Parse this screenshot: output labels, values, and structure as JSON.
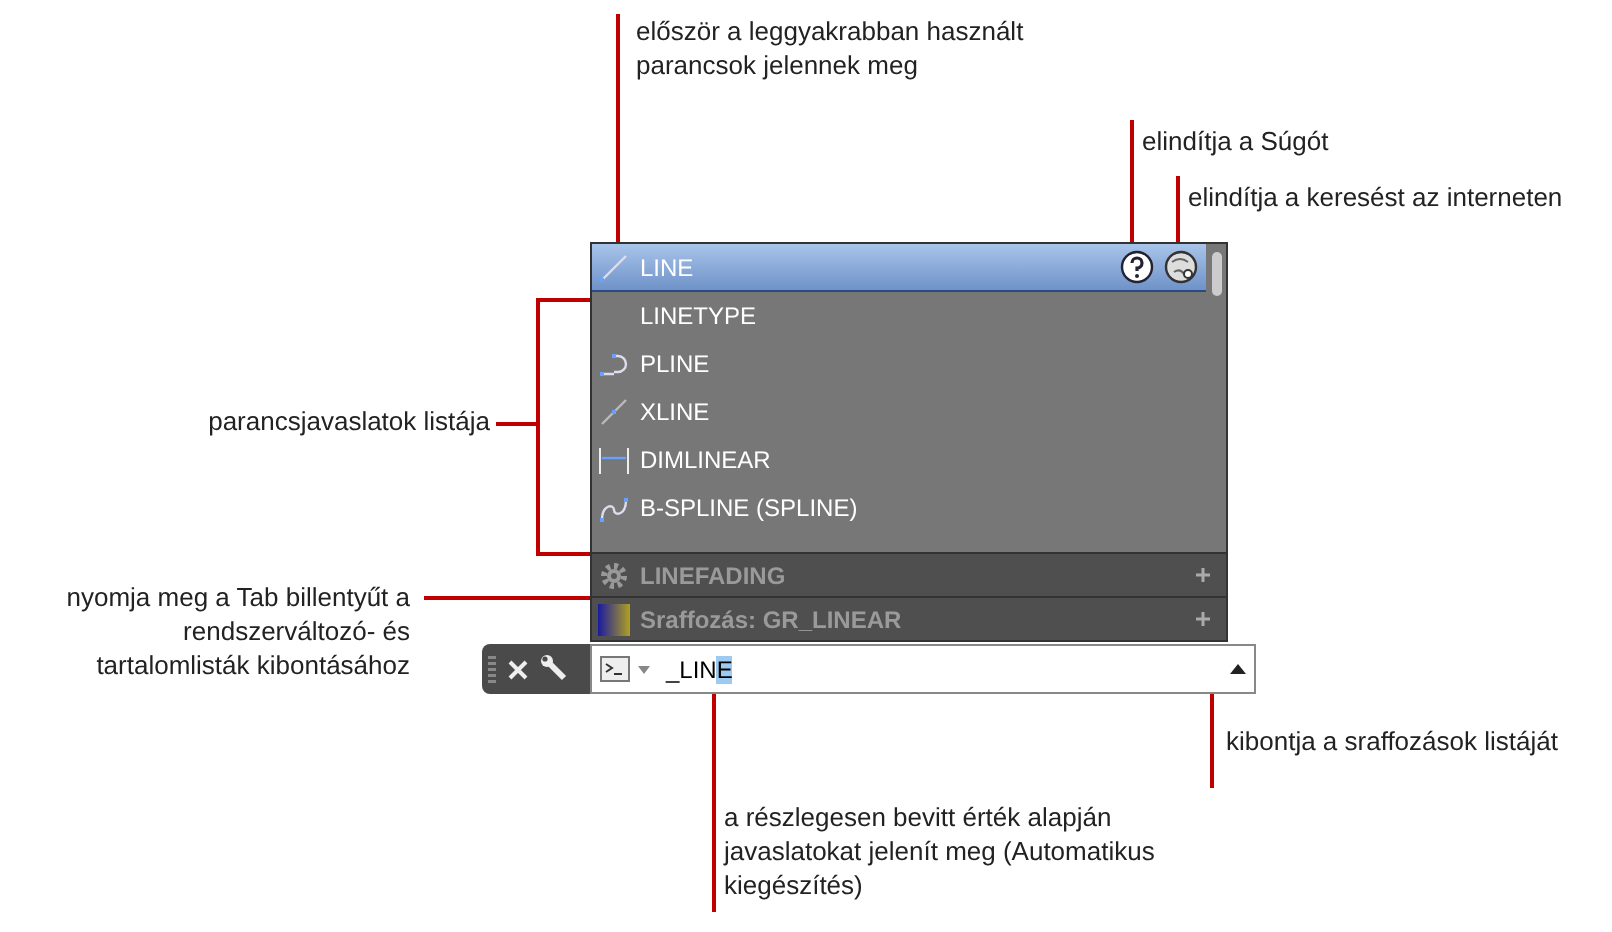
{
  "annotations": [
    {
      "kind": "top",
      "text": "először a leggyakrabban használt parancsok jelennek meg"
    },
    {
      "kind": "help",
      "text": "elindítja a Súgót"
    },
    {
      "kind": "web",
      "text": "elindítja a keresést az interneten"
    },
    {
      "kind": "list",
      "text": "parancsjavaslatok listája"
    },
    {
      "kind": "tab",
      "text": "nyomja meg a Tab billentyűt a rendszerváltozó- és tartalomlisták kibontásához"
    },
    {
      "kind": "expand",
      "text": "kibontja a sraffozások listáját"
    },
    {
      "kind": "auto",
      "text": "a részlegesen bevitt érték alapján javaslatokat jelenít meg (Automatikus kiegészítés)"
    }
  ],
  "suggestions": [
    {
      "kind": "line",
      "label": "LINE",
      "selected": true
    },
    {
      "kind": "none",
      "label": "LINETYPE",
      "selected": false
    },
    {
      "kind": "pline",
      "label": "PLINE",
      "selected": false
    },
    {
      "kind": "xline",
      "label": "XLINE",
      "selected": false
    },
    {
      "kind": "dim",
      "label": "DIMLINEAR",
      "selected": false
    },
    {
      "kind": "spline",
      "label": "B-SPLINE (SPLINE)",
      "selected": false
    }
  ],
  "categories": [
    {
      "kind": "sysvar",
      "label": "LINEFADING",
      "expanded": false
    },
    {
      "kind": "hatch",
      "label": "Sraffozás: GR_LINEAR",
      "expanded": false
    }
  ],
  "command_line": {
    "typed": "_LIN",
    "completion": "E"
  }
}
